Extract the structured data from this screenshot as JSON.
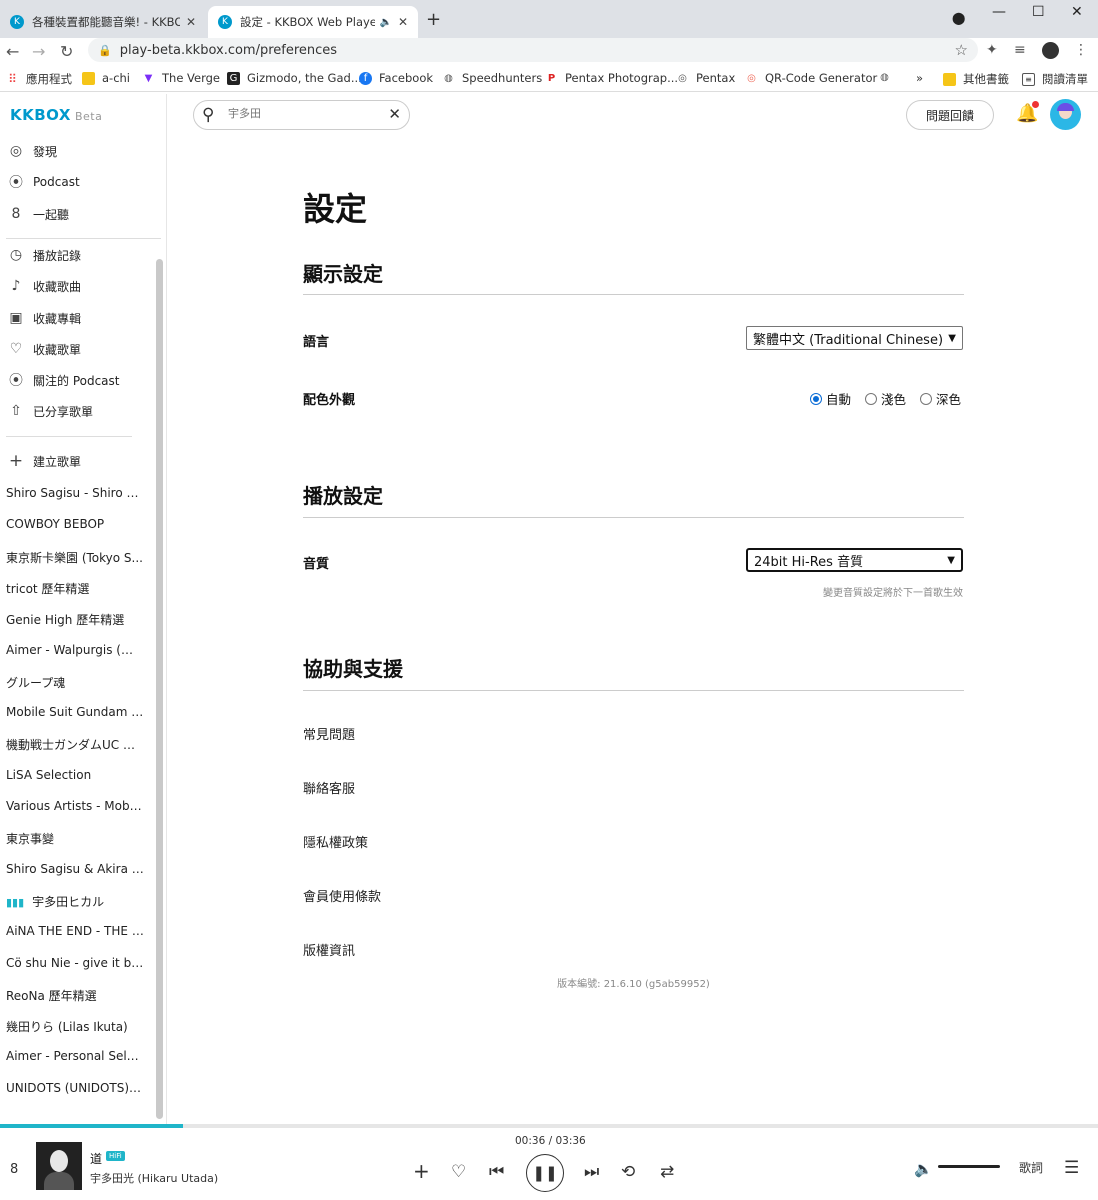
{
  "browser": {
    "tabs": [
      {
        "title": "各種裝置都能聽音樂! - KKBOX",
        "active": false
      },
      {
        "title": "設定 - KKBOX Web Player",
        "active": true
      }
    ],
    "url": "play-beta.kkbox.com/preferences",
    "bookmarks": [
      "應用程式",
      "a-chi",
      "The Verge",
      "Gizmodo, the Gad...",
      "Facebook",
      "Speedhunters",
      "Pentax Photograp...",
      "Pentax",
      "QR-Code Generator"
    ],
    "bookmarks_more": "»",
    "other_bookmarks": "其他書籤",
    "reading_list": "閱讀清單"
  },
  "app": {
    "logo": "KKBOX",
    "logo_badge": "Beta",
    "search": {
      "placeholder": "宇多田"
    },
    "feedback_label": "問題回饋",
    "accent": "#1fb5c9"
  },
  "sidebar": {
    "nav": [
      {
        "label": "發現",
        "icon": "discover-icon"
      },
      {
        "label": "Podcast",
        "icon": "podcast-icon"
      },
      {
        "label": "一起聽",
        "icon": "listen-together-icon"
      }
    ],
    "library": [
      {
        "label": "播放記錄",
        "icon": "history-icon"
      },
      {
        "label": "收藏歌曲",
        "icon": "music-note-icon"
      },
      {
        "label": "收藏專輯",
        "icon": "album-icon"
      },
      {
        "label": "收藏歌單",
        "icon": "heart-icon"
      },
      {
        "label": "關注的 Podcast",
        "icon": "podcast-icon"
      },
      {
        "label": "已分享歌單",
        "icon": "share-icon"
      }
    ],
    "create_playlist": "建立歌單",
    "playlists": [
      "Shiro Sagisu - Shiro Sa...",
      "COWBOY BEBOP",
      "東京斯卡樂園 (Tokyo S...",
      "tricot 歷年精選",
      "Genie High 歷年精選",
      "Aimer - Walpurgis (Wal...",
      "グループ魂",
      "Mobile Suit Gundam T...",
      "機動戦士ガンダムUC オ...",
      "LiSA Selection",
      "Various Artists - Mobile...",
      "東京事變",
      "Shiro Sagisu & Akira Ifu...",
      "宇多田ヒカル",
      "AiNA THE END - THE END",
      "Cö shu Nie - give it bac...",
      "ReoNa 歷年精選",
      "幾田りら (Lilas Ikuta)",
      "Aimer - Personal Select",
      "UNIDOTS (UNIDOTS) - ..."
    ],
    "playing_index": 13
  },
  "main": {
    "title": "設定",
    "display": {
      "heading": "顯示設定",
      "language_label": "語言",
      "language_value": "繁體中文 (Traditional Chinese)",
      "theme_label": "配色外觀",
      "theme_options": [
        "自動",
        "淺色",
        "深色"
      ],
      "theme_selected": "自動"
    },
    "playback": {
      "heading": "播放設定",
      "quality_label": "音質",
      "quality_value": "24bit Hi-Res 音質",
      "quality_note": "變更音質設定將於下一首歌生效"
    },
    "support": {
      "heading": "協助與支援",
      "links": [
        "常見問題",
        "聯絡客服",
        "隱私權政策",
        "會員使用條款",
        "版權資訊"
      ]
    },
    "version": "版本編號: 21.6.10 (g5ab59952)"
  },
  "player": {
    "track": "道",
    "badge": "HiFi",
    "artist": "宇多田光 (Hikaru Utada)",
    "time": "00:36 / 03:36",
    "progress": 0.1667,
    "volume": 0.95,
    "lyrics_label": "歌詞"
  }
}
